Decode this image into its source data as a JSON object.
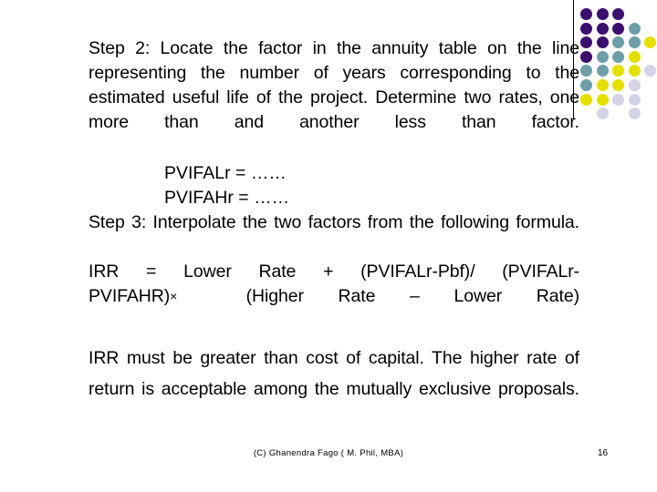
{
  "slide": {
    "paragraphs": {
      "step2": "Step 2: Locate the factor in the annuity table on the line representing the number of years corresponding to the estimated useful life of the project. Determine two rates, one more than and another less than factor.",
      "pvifalr": "PVIFALr = ……",
      "pvifahr": "PVIFAHr = ……",
      "step3": "Step 3: Interpolate the two factors from the following formula.",
      "formula_part1": "IRR = Lower Rate + (PVIFALr-Pbf)/ (PVIFALr-PVIFAHR)",
      "formula_multiply": "×",
      "formula_part2": "(Higher Rate – Lower Rate)",
      "conclusion": "IRR must be greater than cost of capital. The higher rate of return is acceptable among the mutually exclusive proposals."
    }
  },
  "footer": {
    "credit": "(C) Ghanendra Fago ( M. Phil, MBA)",
    "page_number": "16"
  },
  "decoration": {
    "colors": {
      "dark_purple": "#3B0F6E",
      "teal": "#6E9FA8",
      "yellow": "#E6E000",
      "lavender": "#D3D3E6"
    },
    "dot_grid": [
      [
        "dark_purple",
        "dark_purple",
        "dark_purple",
        null,
        null
      ],
      [
        "dark_purple",
        "dark_purple",
        "dark_purple",
        "teal",
        null
      ],
      [
        "dark_purple",
        "dark_purple",
        "teal",
        "teal",
        "yellow"
      ],
      [
        "dark_purple",
        "teal",
        "teal",
        "yellow",
        null
      ],
      [
        "teal",
        "teal",
        "yellow",
        "yellow",
        "lavender"
      ],
      [
        "teal",
        "yellow",
        "yellow",
        "lavender",
        null
      ],
      [
        "yellow",
        "yellow",
        "lavender",
        "lavender",
        null
      ],
      [
        null,
        "lavender",
        null,
        "lavender",
        null
      ]
    ]
  }
}
